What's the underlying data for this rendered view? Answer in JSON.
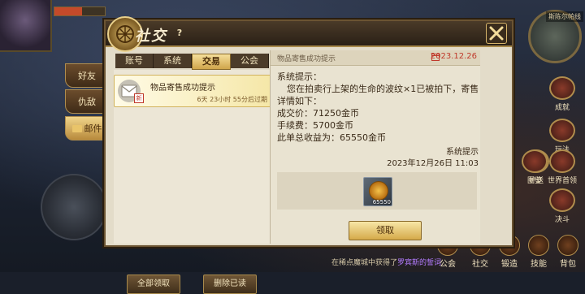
{
  "panel": {
    "title": "社交",
    "help_label": "?"
  },
  "side_tabs": [
    {
      "label": "好友"
    },
    {
      "label": "仇敌"
    },
    {
      "label": "邮件"
    }
  ],
  "tabs": [
    {
      "label": "账号"
    },
    {
      "label": "系统"
    },
    {
      "label": "交易"
    },
    {
      "label": "公会"
    }
  ],
  "active_tab_index": 2,
  "mail_list": [
    {
      "title": "物品寄售成功提示",
      "time_left": "6天 23小时 55分后过期",
      "new_badge": "新"
    }
  ],
  "detail": {
    "subject": "物品寄售成功提示",
    "date": "2023.12.26",
    "body": [
      "系统提示：",
      "您在拍卖行上架的生命的波纹×1已被拍下，寄售",
      "详情如下：",
      "成交价：71250金币",
      "手续费：5700金币",
      "此单总收益为：65550金币"
    ],
    "sender": "系统提示",
    "timestamp": "2023年12月26日 11:03",
    "attachment_qty": "65550",
    "claim_label": "领取"
  },
  "list_buttons": {
    "claim_all": "全部领取",
    "delete_read": "删除已读"
  },
  "hud": {
    "map_tag": "斯陈尔帕线",
    "right_items": [
      {
        "label": "成就"
      },
      {
        "label": "玩法"
      },
      {
        "label": "护送"
      },
      {
        "label": "图鉴"
      },
      {
        "label": "世界首领"
      },
      {
        "label": "决斗"
      }
    ],
    "bottom_items": [
      {
        "label": "公会"
      },
      {
        "label": "社交"
      },
      {
        "label": "锻造"
      },
      {
        "label": "技能"
      },
      {
        "label": "背包"
      }
    ],
    "chat_prefix": "在稀点魔城中获得了",
    "chat_highlight": "罗宾斯的誓词"
  },
  "colors": {
    "accent_gold": "#d5aa4a",
    "date_red": "#c0392b",
    "panel_bg": "#e3dcc9"
  }
}
